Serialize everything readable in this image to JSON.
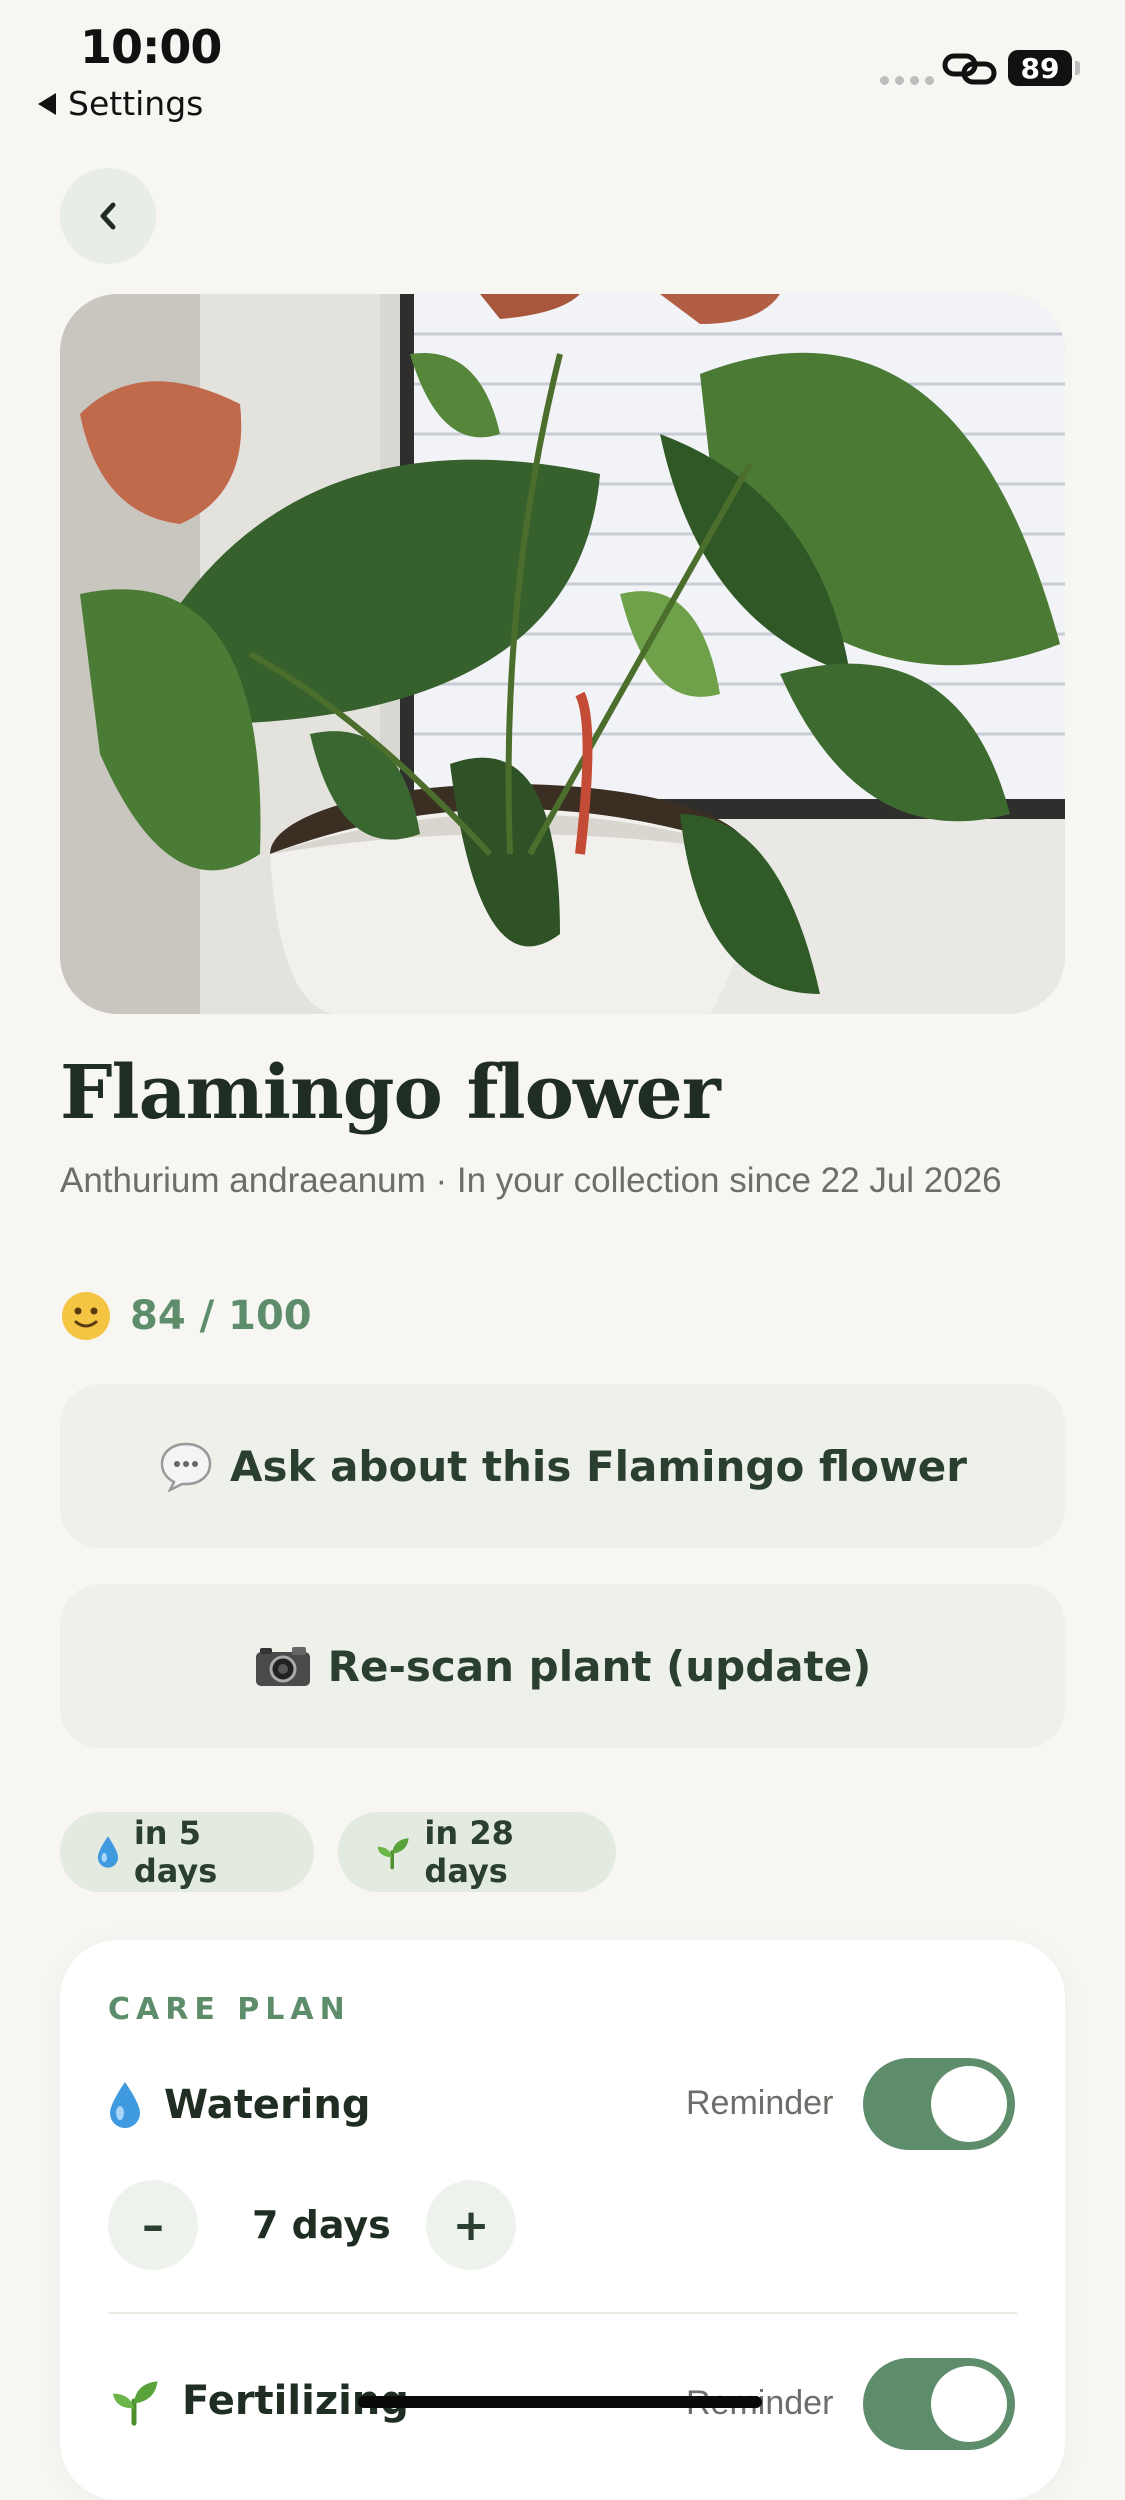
{
  "status_bar": {
    "time": "10:00",
    "back_app": "Settings",
    "battery": "89"
  },
  "plant": {
    "name": "Flamingo flower",
    "subtitle": "Anthurium andraeanum · In your collection since 22 Jul 2026",
    "score": "84 / 100"
  },
  "actions": {
    "ask": "Ask about this Flamingo flower",
    "rescan": "Re-scan plant (update)"
  },
  "next_care": {
    "watering": "in 5 days",
    "fertilizing": "in 28 days"
  },
  "care_plan": {
    "heading": "CARE PLAN",
    "items": [
      {
        "name": "Watering",
        "reminder_label": "Reminder",
        "reminder_on": true,
        "interval": "7 days",
        "icon": "water-drop-icon"
      },
      {
        "name": "Fertilizing",
        "reminder_label": "Reminder",
        "reminder_on": true,
        "icon": "seedling-icon"
      }
    ]
  },
  "colors": {
    "accent": "#5e8d6c",
    "background": "#f7f6f2",
    "button_bg": "#edf1ea"
  }
}
